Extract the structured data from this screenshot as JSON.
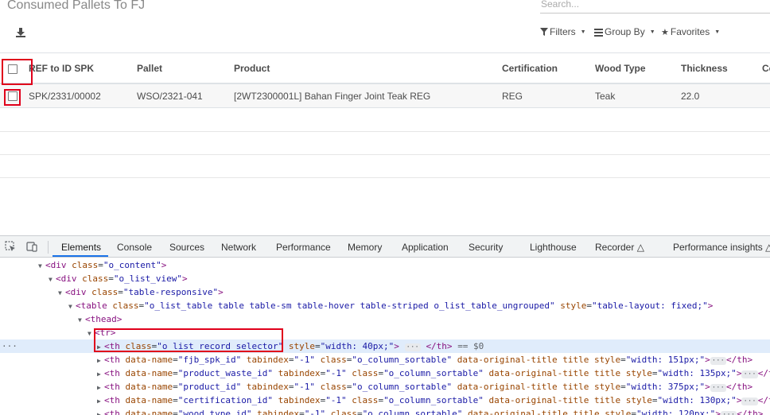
{
  "app": {
    "title": "Consumed Pallets To FJ",
    "search_placeholder": "Search...",
    "toolbar": {
      "filters_label": "Filters",
      "group_by_label": "Group By",
      "favorites_label": "Favorites"
    },
    "columns": [
      "REF to ID SPK",
      "Pallet",
      "Product",
      "Certification",
      "Wood Type",
      "Thickness",
      "Co"
    ],
    "rows": [
      {
        "ref": "SPK/2331/00002",
        "pallet": "WSO/2321-041",
        "product": "[2WT2300001L] Bahan Finger Joint Teak REG",
        "certification": "REG",
        "wood_type": "Teak",
        "thickness": "22.0"
      }
    ]
  },
  "devtools": {
    "tabs": [
      "Elements",
      "Console",
      "Sources",
      "Network",
      "Performance",
      "Memory",
      "Application",
      "Security",
      "Lighthouse",
      "Recorder",
      "Performance insights"
    ],
    "active_tab": "Elements",
    "lines": [
      {
        "t": "<div ",
        "a": "class",
        "v": "\"o_content\"",
        "e": ">"
      },
      {
        "t": "<div ",
        "a": "class",
        "v": "\"o_list_view\"",
        "e": ">"
      },
      {
        "t": "<div ",
        "a": "class",
        "v": "\"table-responsive\"",
        "e": ">"
      },
      {
        "t": "<table ",
        "a": "class",
        "v": "\"o_list_table table table-sm table-hover table-striped o_list_table_ungrouped\"",
        "a2": " style",
        "v2": "\"table-layout: fixed;\"",
        "e": ">"
      },
      {
        "t": "<thead>"
      },
      {
        "t": "<tr>"
      },
      {
        "t": "<th ",
        "a": "class",
        "v": "\"o_list_record_selector\"",
        "a2": " style",
        "v2": "\"width: 40px;\"",
        "e": ">",
        "close": "</th>",
        "tail": "== $0"
      },
      {
        "t": "<th ",
        "a": "data-name",
        "v": "\"fjb_spk_id\"",
        "a2": " tabindex",
        "v2": "\"-1\"",
        "a3": " class",
        "v3": "\"o_column_sortable\"",
        "a4": " data-original-title title",
        "a5": " style",
        "v5": "\"width: 151px;\"",
        "e": ">",
        "close": "</th>"
      },
      {
        "t": "<th ",
        "a": "data-name",
        "v": "\"product_waste_id\"",
        "a2": " tabindex",
        "v2": "\"-1\"",
        "a3": " class",
        "v3": "\"o_column_sortable\"",
        "a4": " data-original-title title",
        "a5": " style",
        "v5": "\"width: 135px;\"",
        "e": ">",
        "close": "</th>"
      },
      {
        "t": "<th ",
        "a": "data-name",
        "v": "\"product_id\"",
        "a2": " tabindex",
        "v2": "\"-1\"",
        "a3": " class",
        "v3": "\"o_column_sortable\"",
        "a4": " data-original-title title",
        "a5": " style",
        "v5": "\"width: 375px;\"",
        "e": ">",
        "close": "</th>"
      },
      {
        "t": "<th ",
        "a": "data-name",
        "v": "\"certification_id\"",
        "a2": " tabindex",
        "v2": "\"-1\"",
        "a3": " class",
        "v3": "\"o_column_sortable\"",
        "a4": " data-original-title title",
        "a5": " style",
        "v5": "\"width: 130px;\"",
        "e": ">",
        "close": "</th>"
      },
      {
        "t": "<th ",
        "a": "data-name",
        "v": "\"wood_type_id\"",
        "a2": " tabindex",
        "v2": "\"-1\"",
        "a3": " class",
        "v3": "\"o_column_sortable\"",
        "a4": " data-original-title title",
        "a5": " style",
        "v5": "\"width: 120px;\"",
        "e": ">",
        "close": "</th>"
      }
    ]
  }
}
